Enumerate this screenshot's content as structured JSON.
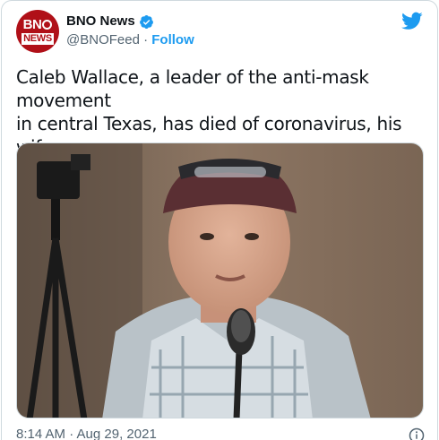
{
  "author": {
    "name": "BNO News",
    "handle": "@BNOFeed",
    "separator": "·",
    "follow_label": "Follow",
    "avatar_line1": "BN",
    "avatar_line2": "NEWS"
  },
  "tweet": {
    "text": "Caleb Wallace, a leader of the anti-mask movement\nin central Texas, has died of coronavirus, his wife\nsays - NYT",
    "timestamp": "8:14 AM · Aug 29, 2021"
  },
  "icons": {
    "verified": "verified-badge-icon",
    "brand": "twitter-bird-icon",
    "info": "info-icon"
  },
  "colors": {
    "accent": "#1d9bf0",
    "avatar_red": "#b01018",
    "secondary_text": "#536471"
  }
}
